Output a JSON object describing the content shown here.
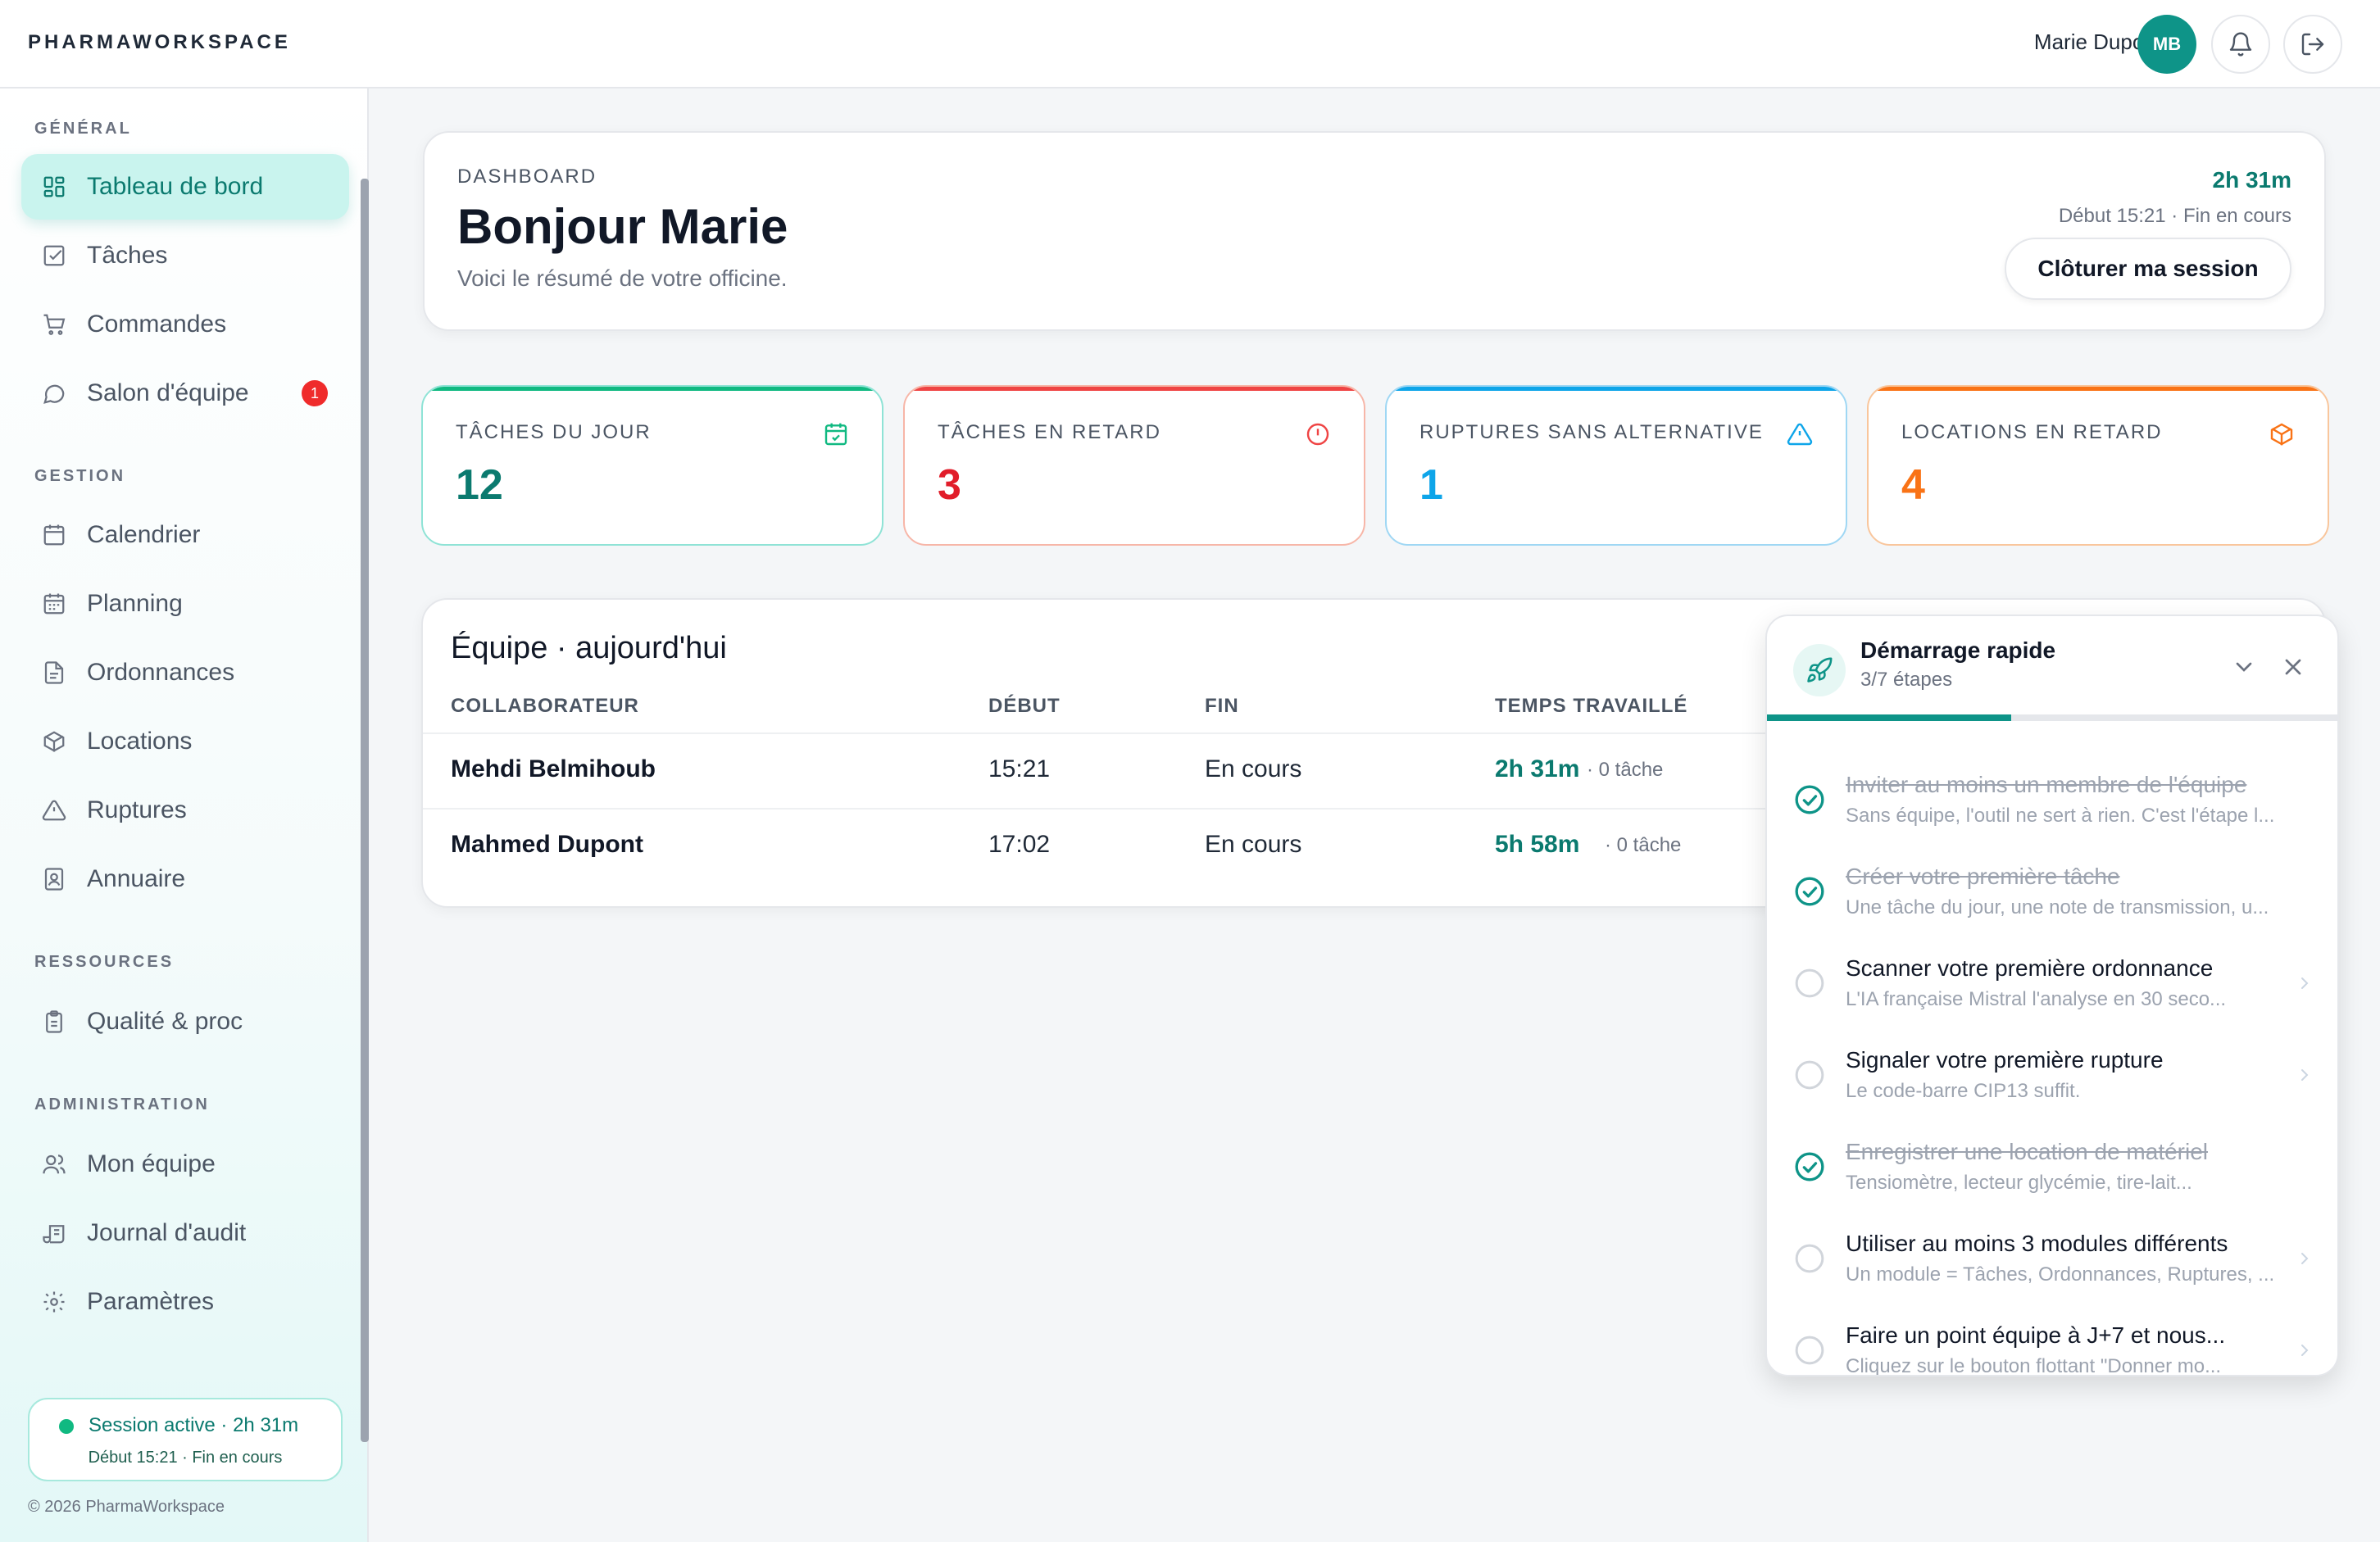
{
  "app": {
    "brand": "PHARMAWORKSPACE"
  },
  "header": {
    "user_name": "Marie Dupont",
    "avatar_initials": "MB"
  },
  "sidebar": {
    "sections": [
      {
        "label": "GÉNÉRAL"
      },
      {
        "label": "GESTION"
      },
      {
        "label": "RESSOURCES"
      },
      {
        "label": "ADMINISTRATION"
      }
    ],
    "items": [
      {
        "label": "Tableau de bord",
        "icon": "grid-icon",
        "active": true
      },
      {
        "label": "Tâches",
        "icon": "checkbox-icon"
      },
      {
        "label": "Commandes",
        "icon": "cart-icon"
      },
      {
        "label": "Salon d'équipe",
        "icon": "chat-icon",
        "badge": "1"
      },
      {
        "label": "Calendrier",
        "icon": "calendar-icon"
      },
      {
        "label": "Planning",
        "icon": "calendar-grid-icon"
      },
      {
        "label": "Ordonnances",
        "icon": "document-icon"
      },
      {
        "label": "Locations",
        "icon": "box-icon"
      },
      {
        "label": "Ruptures",
        "icon": "warning-icon"
      },
      {
        "label": "Annuaire",
        "icon": "contact-book-icon"
      },
      {
        "label": "Qualité & proc",
        "icon": "clipboard-icon"
      },
      {
        "label": "Mon équipe",
        "icon": "users-icon"
      },
      {
        "label": "Journal d'audit",
        "icon": "scroll-icon"
      },
      {
        "label": "Paramètres",
        "icon": "gear-icon"
      }
    ],
    "session": {
      "title": "Session active · 2h 31m",
      "sub": "Début 15:21 · Fin en cours"
    },
    "copyright": "© 2026 PharmaWorkspace"
  },
  "hero": {
    "eyebrow": "DASHBOARD",
    "title": "Bonjour Marie",
    "subtitle": "Voici le résumé de votre officine.",
    "time": "2h 31m",
    "range": "Début 15:21 · Fin en cours",
    "close_label": "Clôturer ma session"
  },
  "stats": [
    {
      "label": "TÂCHES DU JOUR",
      "value": "12",
      "color": "#0b7a6f",
      "icon": "calendar-check-icon"
    },
    {
      "label": "TÂCHES EN RETARD",
      "value": "3",
      "color": "#e11d2a",
      "icon": "alert-circle-icon"
    },
    {
      "label": "RUPTURES SANS ALTERNATIVE",
      "value": "1",
      "color": "#0ea5e9",
      "icon": "warning-icon"
    },
    {
      "label": "LOCATIONS EN RETARD",
      "value": "4",
      "color": "#f97316",
      "icon": "box-icon"
    }
  ],
  "team": {
    "title": "Équipe · aujourd'hui",
    "columns": [
      "COLLABORATEUR",
      "DÉBUT",
      "FIN",
      "TEMPS TRAVAILLÉ"
    ],
    "rows": [
      {
        "name": "Mehdi Belmihoub",
        "start": "15:21",
        "end": "En cours",
        "time": "2h 31m",
        "tasks": "· 0 tâche"
      },
      {
        "name": "Mahmed Dupont",
        "start": "17:02",
        "end": "En cours",
        "time": "5h 58m",
        "tasks": "· 0 tâche"
      }
    ]
  },
  "quickstart": {
    "title": "Démarrage rapide",
    "progress_text": "3/7 étapes",
    "progress": 0.4286,
    "steps": [
      {
        "title": "Inviter au moins un membre de l'équipe",
        "desc": "Sans équipe, l'outil ne sert à rien. C'est l'étape l...",
        "done": true
      },
      {
        "title": "Créer votre première tâche",
        "desc": "Une tâche du jour, une note de transmission, u...",
        "done": true
      },
      {
        "title": "Scanner votre première ordonnance",
        "desc": "L'IA française Mistral l'analyse en 30 seco...",
        "done": false
      },
      {
        "title": "Signaler votre première rupture",
        "desc": "Le code-barre CIP13 suffit.",
        "done": false
      },
      {
        "title": "Enregistrer une location de matériel",
        "desc": "Tensiomètre, lecteur glycémie, tire-lait...",
        "done": true
      },
      {
        "title": "Utiliser au moins 3 modules différents",
        "desc": "Un module = Tâches, Ordonnances, Ruptures, ...",
        "done": false
      },
      {
        "title": "Faire un point équipe à J+7 et nous...",
        "desc": "Cliquez sur le bouton flottant \"Donner mo...",
        "done": false
      }
    ]
  }
}
